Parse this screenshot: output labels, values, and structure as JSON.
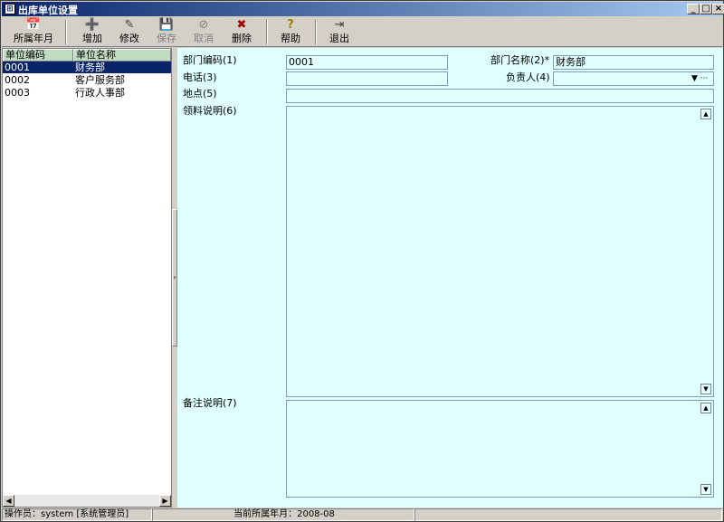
{
  "window": {
    "title": "出库单位设置",
    "min_glyph": "_",
    "max_glyph": "□",
    "close_glyph": "×"
  },
  "toolbar": {
    "items": [
      {
        "label": "所属年月",
        "icon": "calendar-icon",
        "glyph": "📅",
        "enabled": true
      },
      {
        "label": "增加",
        "icon": "add-icon",
        "glyph": "➕",
        "enabled": true
      },
      {
        "label": "修改",
        "icon": "edit-icon",
        "glyph": "✎",
        "enabled": true
      },
      {
        "label": "保存",
        "icon": "save-icon",
        "glyph": "💾",
        "enabled": false
      },
      {
        "label": "取消",
        "icon": "cancel-icon",
        "glyph": "⊘",
        "enabled": false
      },
      {
        "label": "删除",
        "icon": "delete-icon",
        "glyph": "✖",
        "enabled": true
      },
      {
        "label": "帮助",
        "icon": "help-icon",
        "glyph": "?",
        "enabled": true
      },
      {
        "label": "退出",
        "icon": "exit-icon",
        "glyph": "⇥",
        "enabled": true
      }
    ]
  },
  "unit_list": {
    "columns": [
      "单位编码",
      "单位名称"
    ],
    "rows": [
      {
        "code": "0001",
        "name": "财务部",
        "selected": true
      },
      {
        "code": "0002",
        "name": "客户服务部",
        "selected": false
      },
      {
        "code": "0003",
        "name": "行政人事部",
        "selected": false
      }
    ]
  },
  "form": {
    "dept_code_label": "部门编码(1)",
    "dept_code_value": "0001",
    "dept_name_label": "部门名称(2)*",
    "dept_name_value": "财务部",
    "phone_label": "电话(3)",
    "phone_value": "",
    "manager_label": "负责人(4)",
    "manager_value": "",
    "location_label": "地点(5)",
    "location_value": "",
    "material_note_label": "领料说明(6)",
    "remark_label": "备注说明(7)"
  },
  "statusbar": {
    "operator": "操作员：system [系统管理员]",
    "current_period": "当前所属年月：2008-08"
  },
  "colors": {
    "form_bg": "#e0ffff",
    "grid_header": "#c0dcc0",
    "selection": "#0a246a",
    "titlebar_start": "#0a246a"
  }
}
